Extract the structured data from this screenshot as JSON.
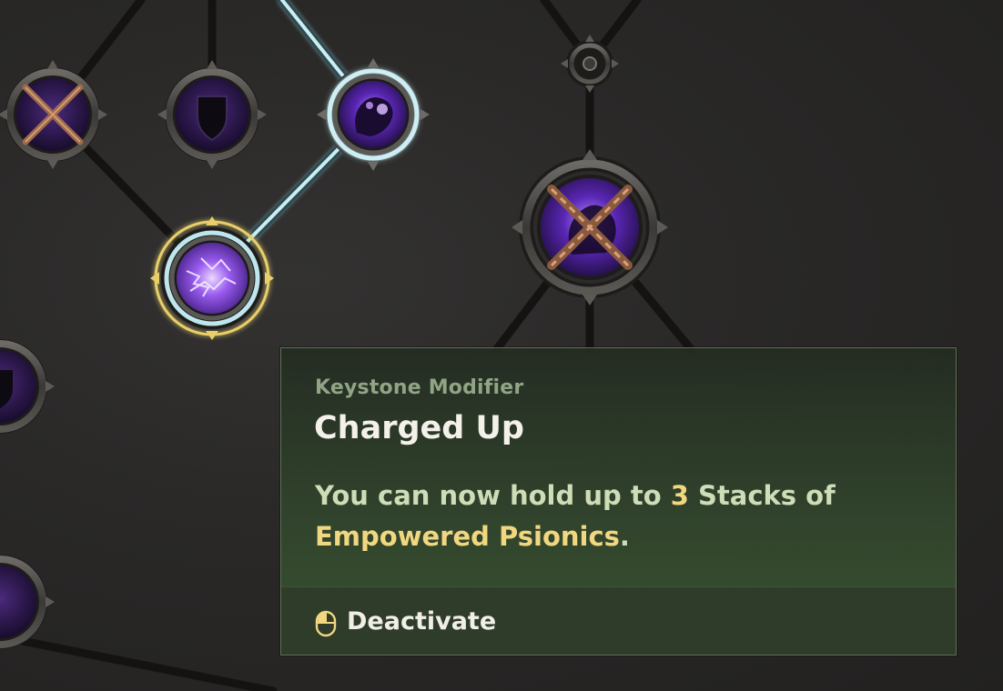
{
  "tooltip": {
    "category": "Keystone Modifier",
    "title": "Charged Up",
    "description": {
      "part1": "You can now hold up to ",
      "count": "3",
      "part2": " Stacks of ",
      "keyword": "Empowered Psionics",
      "part3": "."
    },
    "action": {
      "icon": "mouse-left-click-icon",
      "label": "Deactivate"
    }
  },
  "skill_tree": {
    "nodes": [
      {
        "name": "locked-chained-node",
        "state": "locked",
        "icon": "crossed-chains-icon"
      },
      {
        "name": "shield-node",
        "state": "available",
        "icon": "shield-icon"
      },
      {
        "name": "psionic-fist-node",
        "state": "allocated",
        "icon": "psionic-fist-icon"
      },
      {
        "name": "charged-up-node",
        "state": "selected",
        "icon": "lightning-hand-icon"
      },
      {
        "name": "small-connector-node",
        "state": "available",
        "icon": "dot-icon"
      },
      {
        "name": "keystone-chained-node",
        "state": "locked",
        "icon": "crossed-chains-icon"
      },
      {
        "name": "left-edge-shield-node",
        "state": "available",
        "icon": "shield-icon"
      },
      {
        "name": "left-edge-bottom-node",
        "state": "available",
        "icon": "psionic-icon"
      }
    ]
  },
  "colors": {
    "allocated_path": "#bfe6ec",
    "selected_ring": "#e8cf6a",
    "highlight_text": "#f2d781",
    "psionic_purple": "#7d3fd6"
  }
}
